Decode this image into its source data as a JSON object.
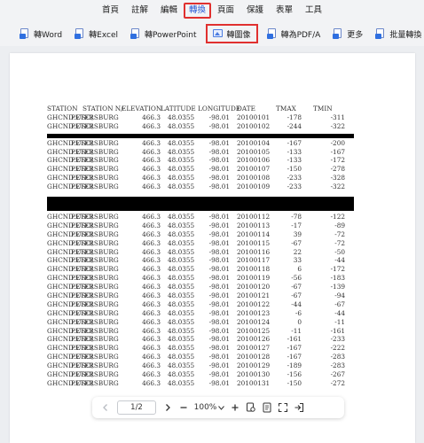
{
  "menu": {
    "items": [
      {
        "label": "首頁",
        "active": false
      },
      {
        "label": "註解",
        "active": false
      },
      {
        "label": "編輯",
        "active": false
      },
      {
        "label": "轉換",
        "active": true
      },
      {
        "label": "頁面",
        "active": false
      },
      {
        "label": "保護",
        "active": false
      },
      {
        "label": "表單",
        "active": false
      },
      {
        "label": "工具",
        "active": false
      }
    ]
  },
  "toolbar": {
    "word": "轉Word",
    "excel": "轉Excel",
    "ppt": "轉PowerPoint",
    "image": "轉圖像",
    "pdfa": "轉為PDF/A",
    "more": "更多",
    "batch": "批量轉換"
  },
  "table": {
    "headers": [
      "STATION",
      "STATION N/",
      "ELEVATION",
      "LATITUDE",
      "LONGITUDE",
      "DATE",
      "TMAX",
      "TMIN"
    ],
    "group1": [
      [
        "GHCND:USC(",
        "PETERSBURG",
        "466.3",
        "48.0355",
        "-98.01",
        "20100101",
        "-178",
        "-311"
      ],
      [
        "GHCND:USC(",
        "PETERSBURG",
        "466.3",
        "48.0355",
        "-98.01",
        "20100102",
        "-244",
        "-322"
      ]
    ],
    "group2": [
      [
        "GHCND:USC(",
        "PETERSBURG",
        "466.3",
        "48.0355",
        "-98.01",
        "20100104",
        "-167",
        "-200"
      ],
      [
        "GHCND:USC(",
        "PETERSBURG",
        "466.3",
        "48.0355",
        "-98.01",
        "20100105",
        "-133",
        "-167"
      ],
      [
        "GHCND:USC(",
        "PETERSBURG",
        "466.3",
        "48.0355",
        "-98.01",
        "20100106",
        "-133",
        "-172"
      ],
      [
        "GHCND:USC(",
        "PETERSBURG",
        "466.3",
        "48.0355",
        "-98.01",
        "20100107",
        "-150",
        "-278"
      ],
      [
        "GHCND:USC(",
        "PETERSBURG",
        "466.3",
        "48.0355",
        "-98.01",
        "20100108",
        "-233",
        "-328"
      ],
      [
        "GHCND:USC(",
        "PETERSBURG",
        "466.3",
        "48.0355",
        "-98.01",
        "20100109",
        "-233",
        "-322"
      ]
    ],
    "group3": [
      [
        "GHCND:USC(",
        "PETERSBURG",
        "466.3",
        "48.0355",
        "-98.01",
        "20100112",
        "-78",
        "-122"
      ],
      [
        "GHCND:USC(",
        "PETERSBURG",
        "466.3",
        "48.0355",
        "-98.01",
        "20100113",
        "-17",
        "-89"
      ],
      [
        "GHCND:USC(",
        "PETERSBURG",
        "466.3",
        "48.0355",
        "-98.01",
        "20100114",
        "39",
        "-72"
      ],
      [
        "GHCND:USC(",
        "PETERSBURG",
        "466.3",
        "48.0355",
        "-98.01",
        "20100115",
        "-67",
        "-72"
      ],
      [
        "GHCND:USC(",
        "PETERSBURG",
        "466.3",
        "48.0355",
        "-98.01",
        "20100116",
        "22",
        "-50"
      ],
      [
        "GHCND:USC(",
        "PETERSBURG",
        "466.3",
        "48.0355",
        "-98.01",
        "20100117",
        "33",
        "-44"
      ],
      [
        "GHCND:USC(",
        "PETERSBURG",
        "466.3",
        "48.0355",
        "-98.01",
        "20100118",
        "6",
        "-172"
      ],
      [
        "GHCND:USC(",
        "PETERSBURG",
        "466.3",
        "48.0355",
        "-98.01",
        "20100119",
        "-56",
        "-183"
      ],
      [
        "GHCND:USC(",
        "PETERSBURG",
        "466.3",
        "48.0355",
        "-98.01",
        "20100120",
        "-67",
        "-139"
      ],
      [
        "GHCND:USC(",
        "PETERSBURG",
        "466.3",
        "48.0355",
        "-98.01",
        "20100121",
        "-67",
        "-94"
      ],
      [
        "GHCND:USC(",
        "PETERSBURG",
        "466.3",
        "48.0355",
        "-98.01",
        "20100122",
        "-44",
        "-67"
      ],
      [
        "GHCND:USC(",
        "PETERSBURG",
        "466.3",
        "48.0355",
        "-98.01",
        "20100123",
        "-6",
        "-44"
      ],
      [
        "GHCND:USC(",
        "PETERSBURG",
        "466.3",
        "48.0355",
        "-98.01",
        "20100124",
        "0",
        "-11"
      ],
      [
        "GHCND:USC(",
        "PETERSBURG",
        "466.3",
        "48.0355",
        "-98.01",
        "20100125",
        "-11",
        "-161"
      ],
      [
        "GHCND:USC(",
        "PETERSBURG",
        "466.3",
        "48.0355",
        "-98.01",
        "20100126",
        "-161",
        "-233"
      ],
      [
        "GHCND:USC(",
        "PETERSBURG",
        "466.3",
        "48.0355",
        "-98.01",
        "20100127",
        "-167",
        "-222"
      ],
      [
        "GHCND:USC(",
        "PETERSBURG",
        "466.3",
        "48.0355",
        "-98.01",
        "20100128",
        "-167",
        "-283"
      ],
      [
        "GHCND:USC(",
        "PETERSBURG",
        "466.3",
        "48.0355",
        "-98.01",
        "20100129",
        "-189",
        "-283"
      ],
      [
        "GHCND:USC(",
        "PETERSBURG",
        "466.3",
        "48.0355",
        "-98.01",
        "20100130",
        "-156",
        "-267"
      ],
      [
        "GHCND:USC(",
        "PETERSBURG",
        "466.3",
        "48.0355",
        "-98.01",
        "20100131",
        "-150",
        "-272"
      ]
    ]
  },
  "nav": {
    "page": "1/2",
    "zoom": "100%"
  },
  "colors": {
    "accent": "#2a5bd7",
    "highlight_box": "#e0302f"
  }
}
